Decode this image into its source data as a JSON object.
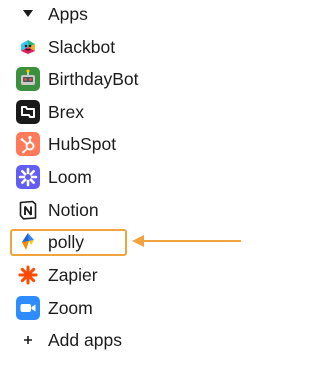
{
  "section": {
    "title": "Apps",
    "caret_icon": "caret-down-icon"
  },
  "apps": [
    {
      "label": "Slackbot",
      "icon": "slackbot-icon"
    },
    {
      "label": "BirthdayBot",
      "icon": "birthdaybot-icon"
    },
    {
      "label": "Brex",
      "icon": "brex-icon"
    },
    {
      "label": "HubSpot",
      "icon": "hubspot-icon"
    },
    {
      "label": "Loom",
      "icon": "loom-icon"
    },
    {
      "label": "Notion",
      "icon": "notion-icon"
    },
    {
      "label": "polly",
      "icon": "polly-icon",
      "highlighted": true
    },
    {
      "label": "Zapier",
      "icon": "zapier-icon"
    },
    {
      "label": "Zoom",
      "icon": "zoom-icon"
    },
    {
      "label": "Add apps",
      "icon": "plus-icon"
    }
  ],
  "colors": {
    "text": "#1d1c1d",
    "highlight": "#f0a33f",
    "brex_bg": "#1a1a1a",
    "hubspot_bg": "#ff7a59",
    "loom_bg": "#625df5",
    "zapier": "#ff4a00",
    "zoom_bg": "#2d8cff",
    "birthdaybot_bg": "#3b8f3e"
  }
}
